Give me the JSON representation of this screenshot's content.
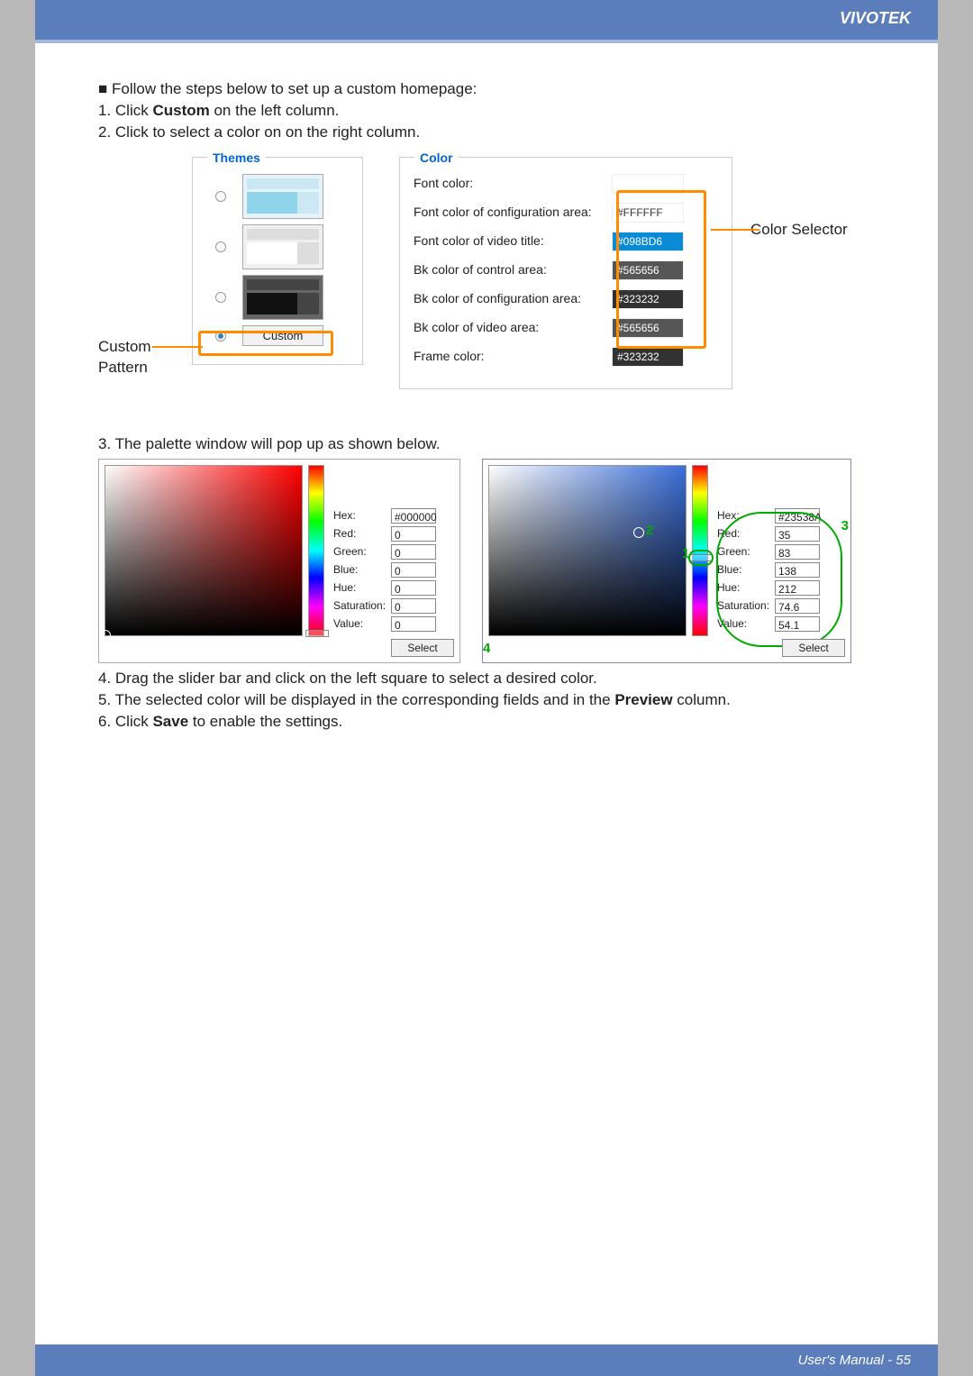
{
  "header": {
    "brand": "VIVOTEK"
  },
  "instructions": {
    "intro": "Follow the steps below to set up a custom homepage:",
    "step1_pre": "1. Click ",
    "step1_bold": "Custom",
    "step1_post": " on the left column.",
    "step2": "2. Click to select a color on on the right column.",
    "step3": "3. The palette window will pop up as shown below.",
    "step4": "4. Drag the slider bar and click on the left square to select a desired color.",
    "step5_pre": "5. The selected color will be displayed in the corresponding fields and in the ",
    "step5_bold": "Preview",
    "step5_post": " column.",
    "step6_pre": "6. Click ",
    "step6_bold": "Save",
    "step6_post": " to enable the settings."
  },
  "diagram": {
    "custom_label1": "Custom",
    "custom_label2": "Pattern",
    "themes_legend": "Themes",
    "custom_btn": "Custom",
    "color_legend": "Color",
    "color_selector": "Color Selector",
    "color_rows": [
      {
        "label": "Font color:",
        "value": ""
      },
      {
        "label": "Font color of configuration area:",
        "value": "#FFFFFF"
      },
      {
        "label": "Font color of video title:",
        "value": "#098BD6"
      },
      {
        "label": "Bk color of control area:",
        "value": "#565656"
      },
      {
        "label": "Bk color of configuration area:",
        "value": "#323232"
      },
      {
        "label": "Bk color of video area:",
        "value": "#565656"
      },
      {
        "label": "Frame color:",
        "value": "#323232"
      }
    ]
  },
  "palette1": {
    "fields": [
      {
        "k": "Hex:",
        "v": "#000000"
      },
      {
        "k": "Red:",
        "v": "0"
      },
      {
        "k": "Green:",
        "v": "0"
      },
      {
        "k": "Blue:",
        "v": "0"
      },
      {
        "k": "Hue:",
        "v": "0"
      },
      {
        "k": "Saturation:",
        "v": "0"
      },
      {
        "k": "Value:",
        "v": "0"
      }
    ],
    "select": "Select"
  },
  "palette2": {
    "fields": [
      {
        "k": "Hex:",
        "v": "#23538A"
      },
      {
        "k": "Red:",
        "v": "35"
      },
      {
        "k": "Green:",
        "v": "83"
      },
      {
        "k": "Blue:",
        "v": "138"
      },
      {
        "k": "Hue:",
        "v": "212"
      },
      {
        "k": "Saturation:",
        "v": "74.6"
      },
      {
        "k": "Value:",
        "v": "54.1"
      }
    ],
    "select": "Select",
    "annot": {
      "1": "1",
      "2": "2",
      "3": "3",
      "4": "4"
    }
  },
  "footer": {
    "text": "User's Manual - 55"
  }
}
